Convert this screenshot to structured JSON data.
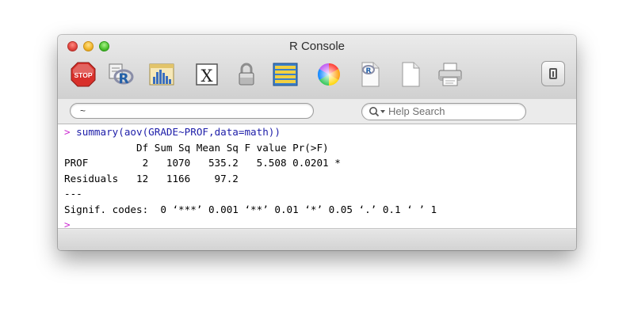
{
  "window": {
    "title": "R Console"
  },
  "toolbar": {
    "icons": [
      {
        "name": "stop-icon",
        "label": "STOP",
        "color": "#d8302b"
      },
      {
        "name": "r-script-icon"
      },
      {
        "name": "bar-chart-icon"
      },
      {
        "name": "x11-icon",
        "label": "X"
      },
      {
        "name": "lock-icon"
      },
      {
        "name": "data-editor-icon"
      },
      {
        "name": "color-wheel-icon"
      },
      {
        "name": "r-document-icon"
      },
      {
        "name": "new-document-icon"
      },
      {
        "name": "printer-icon"
      }
    ],
    "right_widget": "drawer-toggle-icon"
  },
  "pathbar": {
    "working_dir": "~",
    "search_placeholder": "Help Search"
  },
  "console": {
    "lines": [
      {
        "kind": "cmd",
        "prompt": ">",
        "text": " summary(aov(GRADE~PROF,data=math))"
      },
      {
        "kind": "out",
        "text": "            Df Sum Sq Mean Sq F value Pr(>F)  "
      },
      {
        "kind": "out",
        "text": "PROF         2   1070   535.2   5.508 0.0201 *"
      },
      {
        "kind": "out",
        "text": "Residuals   12   1166    97.2                 "
      },
      {
        "kind": "out",
        "text": "---"
      },
      {
        "kind": "out",
        "text": "Signif. codes:  0 ‘***’ 0.001 ‘**’ 0.01 ‘*’ 0.05 ‘.’ 0.1 ‘ ’ 1"
      },
      {
        "kind": "prompt",
        "prompt": ">"
      }
    ]
  },
  "colors": {
    "command_text": "#1c1ca8",
    "prompt": "#cc2ad1",
    "output_text": "#000000"
  }
}
